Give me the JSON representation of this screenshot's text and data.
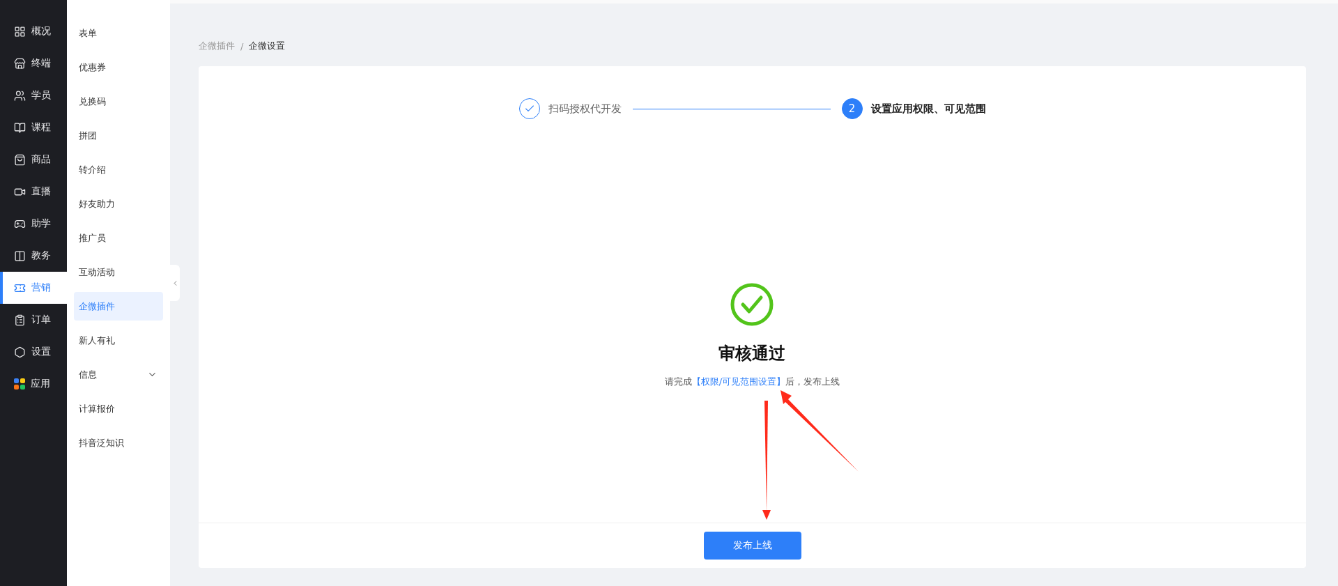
{
  "nav": [
    {
      "label": "概况",
      "selected": false
    },
    {
      "label": "终端",
      "selected": false
    },
    {
      "label": "学员",
      "selected": false
    },
    {
      "label": "课程",
      "selected": false
    },
    {
      "label": "商品",
      "selected": false
    },
    {
      "label": "直播",
      "selected": false
    },
    {
      "label": "助学",
      "selected": false
    },
    {
      "label": "教务",
      "selected": false
    },
    {
      "label": "营销",
      "selected": true
    },
    {
      "label": "订单",
      "selected": false
    },
    {
      "label": "设置",
      "selected": false
    },
    {
      "label": "应用",
      "selected": false
    }
  ],
  "submenu": [
    {
      "label": "表单",
      "selected": false
    },
    {
      "label": "优惠券",
      "selected": false
    },
    {
      "label": "兑换码",
      "selected": false
    },
    {
      "label": "拼团",
      "selected": false
    },
    {
      "label": "转介绍",
      "selected": false
    },
    {
      "label": "好友助力",
      "selected": false
    },
    {
      "label": "推广员",
      "selected": false
    },
    {
      "label": "互动活动",
      "selected": false
    },
    {
      "label": "企微插件",
      "selected": true
    },
    {
      "label": "新人有礼",
      "selected": false
    },
    {
      "label": "信息",
      "selected": false,
      "expanded": false
    },
    {
      "label": "计算报价",
      "selected": false
    },
    {
      "label": "抖音泛知识",
      "selected": false
    }
  ],
  "breadcrumb": {
    "items": [
      "企微插件",
      "企微设置"
    ],
    "separator": "/"
  },
  "steps": [
    {
      "label": "扫码授权代开发",
      "completed": true,
      "active": false
    },
    {
      "label": "设置应用权限、可见范围",
      "completed": false,
      "active": true,
      "number": "2"
    }
  ],
  "result": {
    "title": "审核通过",
    "message_before": "请完成",
    "link": "【权限/可见范围设置】",
    "message_after": "后，发布上线"
  },
  "footer_button": "发布上线"
}
